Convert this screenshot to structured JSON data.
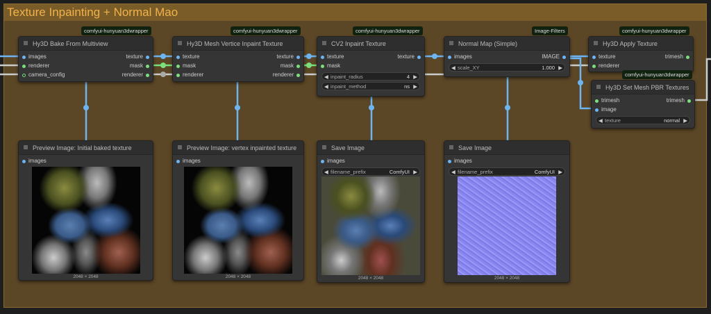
{
  "group": {
    "title": "Texture Inpainting + Normal Mao"
  },
  "nodes": {
    "bake": {
      "badge": "comfyui-hunyuan3dwrapper",
      "title": "Hy3D Bake From Multiview",
      "inputs": [
        "images",
        "renderer",
        "camera_config"
      ],
      "outputs": [
        "texture",
        "mask",
        "renderer"
      ]
    },
    "vinpaint": {
      "badge": "comfyui-hunyuan3dwrapper",
      "title": "Hy3D Mesh Vertice Inpaint Texture",
      "inputs": [
        "texture",
        "mask",
        "renderer"
      ],
      "outputs": [
        "texture",
        "mask",
        "renderer"
      ]
    },
    "cv2": {
      "badge": "comfyui-hunyuan3dwrapper",
      "title": "CV2 Inpaint Texture",
      "inputs": [
        "texture",
        "mask"
      ],
      "outputs": [
        "texture"
      ],
      "widgets": [
        {
          "label": "inpaint_radius",
          "value": "4"
        },
        {
          "label": "inpaint_method",
          "value": "ns"
        }
      ]
    },
    "normal": {
      "badge": "Image-Filters",
      "title": "Normal Map (Simple)",
      "inputs": [
        "images"
      ],
      "outputs": [
        "IMAGE"
      ],
      "widgets": [
        {
          "label": "scale_XY",
          "value": "1.000"
        }
      ]
    },
    "apply": {
      "badge": "comfyui-hunyuan3dwrapper",
      "title": "Hy3D Apply Texture",
      "inputs": [
        "texture",
        "renderer"
      ],
      "outputs": [
        "trimesh"
      ]
    },
    "pbr": {
      "badge": "comfyui-hunyuan3dwrapper",
      "title": "Hy3D Set Mesh PBR Textures",
      "inputs": [
        "trimesh",
        "image"
      ],
      "outputs": [
        "trimesh"
      ],
      "widgets": [
        {
          "label": "texture",
          "value": "normal"
        }
      ]
    },
    "prev1": {
      "title": "Preview Image: Initial baked texture",
      "inputs": [
        "images"
      ],
      "size": "2048 × 2048"
    },
    "prev2": {
      "title": "Preview Image: vertex inpainted texture",
      "inputs": [
        "images"
      ],
      "size": "2048 × 2048"
    },
    "save1": {
      "title": "Save Image",
      "inputs": [
        "images"
      ],
      "widgets": [
        {
          "label": "filename_prefix",
          "value": "ComfyUI"
        }
      ],
      "size": "2048 × 2048"
    },
    "save2": {
      "title": "Save Image",
      "inputs": [
        "images"
      ],
      "widgets": [
        {
          "label": "filename_prefix",
          "value": "ComfyUI"
        }
      ],
      "size": "2048 × 2048"
    }
  }
}
